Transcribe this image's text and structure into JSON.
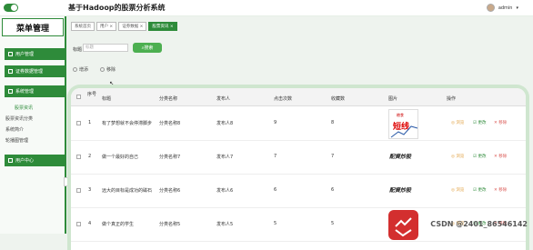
{
  "header": {
    "title": "基于Hadoop的股票分析系统",
    "user": "admin",
    "user_arrow": "▾"
  },
  "sidebar": {
    "title": "菜单管理",
    "groups": [
      {
        "label": "用户管理",
        "icon": "user-icon"
      },
      {
        "label": "证券数据管理",
        "icon": "data-icon"
      },
      {
        "label": "系统管理",
        "icon": "settings-icon"
      },
      {
        "label": "用户中心",
        "icon": "user-center-icon"
      }
    ],
    "sub_items": [
      "股票资讯",
      "股票资讯分类",
      "系统简介",
      "轮播图管理"
    ]
  },
  "tabs": [
    "系统首页",
    "用户 ×",
    "证券数据 ×",
    "股票资讯 ×"
  ],
  "search": {
    "label": "标题",
    "placeholder": "标题",
    "button": "搜索"
  },
  "actions": {
    "add": "增添",
    "delete": "移除"
  },
  "table": {
    "headers": [
      "序号",
      "标题",
      "分类名称",
      "发布人",
      "点击次数",
      "收藏数",
      "图片",
      "操作"
    ],
    "rows": [
      {
        "no": "1",
        "title": "有了梦想就不会停滞脚步",
        "category": "分类名称8",
        "publisher": "发布人8",
        "clicks": "9",
        "favs": "8"
      },
      {
        "no": "2",
        "title": "做一个最好的自己",
        "category": "分类名称7",
        "publisher": "发布人7",
        "clicks": "7",
        "favs": "7"
      },
      {
        "no": "3",
        "title": "远大的目标是成功的磁石",
        "category": "分类名称6",
        "publisher": "发布人6",
        "clicks": "6",
        "favs": "6"
      },
      {
        "no": "4",
        "title": "做个真正的学生",
        "category": "分类名称5",
        "publisher": "发布人5",
        "clicks": "5",
        "favs": "5"
      }
    ],
    "ops": {
      "view": "◎ 浏览",
      "edit": "☑ 更改",
      "del": "✕ 移除"
    },
    "images": [
      {
        "text": "短线",
        "top": "粮食"
      },
      {
        "text": "配資炒股"
      },
      {
        "text": "配資炒股"
      },
      {
        "text": ""
      }
    ]
  },
  "watermark": "CSDN @2401_86546142"
}
